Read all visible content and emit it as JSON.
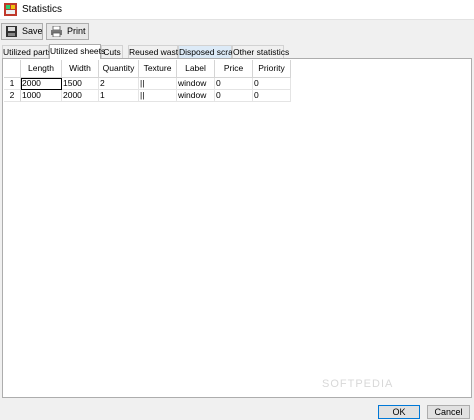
{
  "window": {
    "title": "Statistics"
  },
  "toolbar": {
    "save_label": "Save",
    "print_label": "Print"
  },
  "tabs": [
    {
      "label": "Utilized parts"
    },
    {
      "label": "Utilized sheets"
    },
    {
      "label": "Cuts"
    },
    {
      "label": "Reused waste"
    },
    {
      "label": "Disposed scrap"
    },
    {
      "label": "Other statistics"
    }
  ],
  "active_tab": "Utilized sheets",
  "table": {
    "columns": [
      "Length",
      "Width",
      "Quantity",
      "Texture",
      "Label",
      "Price",
      "Priority"
    ],
    "rows": [
      {
        "num": "1",
        "length": "2000",
        "width": "1500",
        "quantity": "2",
        "texture": "||",
        "label": "window",
        "price": "0",
        "priority": "0"
      },
      {
        "num": "2",
        "length": "1000",
        "width": "2000",
        "quantity": "1",
        "texture": "||",
        "label": "window",
        "price": "0",
        "priority": "0"
      }
    ]
  },
  "buttons": {
    "ok_label": "OK",
    "cancel_label": "Cancel"
  },
  "watermark": "SOFTPEDIA",
  "colors": {
    "accent": "#0078d7",
    "tab_highlight": "#dceaf7"
  }
}
